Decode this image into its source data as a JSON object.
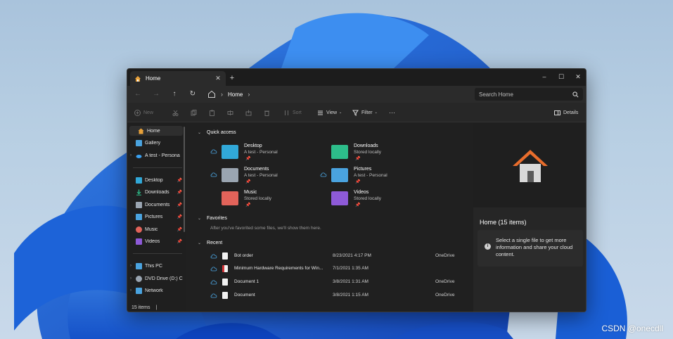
{
  "window": {
    "tab_label": "Home",
    "tab_close": "✕",
    "new_tab": "+",
    "controls": {
      "minimize": "–",
      "maximize": "☐",
      "close": "✕"
    }
  },
  "nav": {
    "back": "←",
    "forward": "→",
    "up": "↑",
    "refresh": "↻",
    "breadcrumb": [
      "Home"
    ],
    "separator": "›",
    "search_placeholder": "Search Home"
  },
  "commands": {
    "new": "New",
    "sort": "Sort",
    "view": "View",
    "filter": "Filter",
    "more": "···",
    "details": "Details"
  },
  "sidebar": {
    "items": [
      {
        "label": "Home",
        "selected": true,
        "icon": "home-icon",
        "color": "#e8a13a"
      },
      {
        "label": "Gallery",
        "icon": "gallery-icon",
        "color": "#4aa3df"
      },
      {
        "label": "A test - Persona",
        "icon": "onedrive-icon",
        "color": "#3aa0f0"
      },
      {
        "label": "Desktop",
        "icon": "desktop-icon",
        "color": "#31a8d8",
        "pinned": true
      },
      {
        "label": "Downloads",
        "icon": "downloads-icon",
        "color": "#2dbd8a",
        "pinned": true
      },
      {
        "label": "Documents",
        "icon": "documents-icon",
        "color": "#9aa5b1",
        "pinned": true
      },
      {
        "label": "Pictures",
        "icon": "pictures-icon",
        "color": "#4aa3df",
        "pinned": true
      },
      {
        "label": "Music",
        "icon": "music-icon",
        "color": "#e2635a",
        "pinned": true
      },
      {
        "label": "Videos",
        "icon": "videos-icon",
        "color": "#8e5ad8",
        "pinned": true
      },
      {
        "label": "This PC",
        "icon": "pc-icon",
        "color": "#4aa3df"
      },
      {
        "label": "DVD Drive (D:) C",
        "icon": "dvd-icon",
        "color": "#9aa5b1"
      },
      {
        "label": "Network",
        "icon": "network-icon",
        "color": "#4aa3df"
      }
    ],
    "pin_glyph": "📌"
  },
  "status": {
    "items": "15 items",
    "sep": "|"
  },
  "main": {
    "quick_access_title": "Quick access",
    "quick_access": [
      {
        "name": "Desktop",
        "sub": "A test - Personal",
        "color": "#31a8d8",
        "icon": "desktop-folder-icon"
      },
      {
        "name": "Downloads",
        "sub": "Stored locally",
        "color": "#2dbd8a",
        "icon": "downloads-folder-icon"
      },
      {
        "name": "Documents",
        "sub": "A test - Personal",
        "color": "#9aa5b1",
        "icon": "documents-folder-icon"
      },
      {
        "name": "Pictures",
        "sub": "A test - Personal",
        "color": "#4aa3df",
        "icon": "pictures-folder-icon"
      },
      {
        "name": "Music",
        "sub": "Stored locally",
        "color": "#e2635a",
        "icon": "music-folder-icon"
      },
      {
        "name": "Videos",
        "sub": "Stored locally",
        "color": "#8e5ad8",
        "icon": "videos-folder-icon"
      }
    ],
    "favorites_title": "Favorites",
    "favorites_empty": "After you've favorited some files, we'll show them here.",
    "recent_title": "Recent",
    "recent": [
      {
        "name": "Bot order",
        "date": "8/23/2021 4:17 PM",
        "location": "OneDrive",
        "type": "doc"
      },
      {
        "name": "Minimum Hardware Requirements for Win...",
        "date": "7/1/2021 1:35 AM",
        "location": "",
        "type": "pdf"
      },
      {
        "name": "Document 1",
        "date": "3/8/2021 1:31 AM",
        "location": "OneDrive",
        "type": "doc"
      },
      {
        "name": "Document",
        "date": "3/8/2021 1:15 AM",
        "location": "OneDrive",
        "type": "doc"
      }
    ]
  },
  "details": {
    "title": "Home (15 items)",
    "info": "Select a single file to get more information and share your cloud content.",
    "info_glyph": "i"
  },
  "watermark": "CSDN @onecdll",
  "colors": {
    "accent": "#4aa3df",
    "window_bg": "#202020",
    "house_roof": "#e96d2c",
    "house_body": "#d9d9d9"
  }
}
